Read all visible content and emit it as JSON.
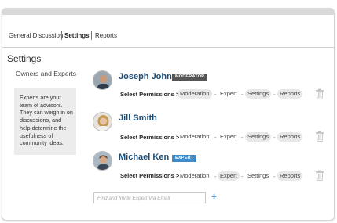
{
  "tabs": {
    "general": "General Discussion",
    "settings": "Settings",
    "reports": "Reports"
  },
  "page_title": "Settings",
  "section_label": "Owners and Experts",
  "info_text": "Experts are your team of advisors. They can weigh in on discussions, and help determine the usefulness of community ideas.",
  "permissions_label": "Select Permissions >",
  "people": [
    {
      "name": "Joseph John",
      "badge": "MODERATOR",
      "badge_color": "#555555",
      "permissions": [
        {
          "label": "Moderation",
          "enabled": true
        },
        {
          "label": "Expert",
          "enabled": false
        },
        {
          "label": "Settings",
          "enabled": true
        },
        {
          "label": "Reports",
          "enabled": true
        }
      ]
    },
    {
      "name": "Jill Smith",
      "badge": "",
      "badge_color": "",
      "permissions": [
        {
          "label": "Moderation",
          "enabled": false
        },
        {
          "label": "Expert",
          "enabled": false
        },
        {
          "label": "Settings",
          "enabled": true
        },
        {
          "label": "Reports",
          "enabled": true
        }
      ]
    },
    {
      "name": "Michael Ken",
      "badge": "EXPERT",
      "badge_color": "#3f8bc9",
      "permissions": [
        {
          "label": "Moderation",
          "enabled": false
        },
        {
          "label": "Expert",
          "enabled": true
        },
        {
          "label": "Settings",
          "enabled": false
        },
        {
          "label": "Reports",
          "enabled": true
        }
      ]
    }
  ],
  "invite": {
    "placeholder": "Find and Invite Expert Via Email",
    "add_symbol": "+"
  },
  "icons": {
    "trash": "trash-icon",
    "add": "plus-icon"
  }
}
